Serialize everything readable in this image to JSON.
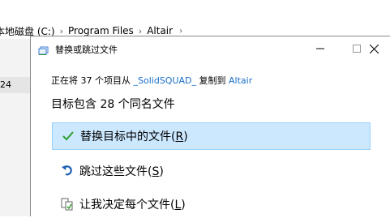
{
  "explorer": {
    "breadcrumb": [
      "本地磁盘 (C:)",
      "Program Files",
      "Altair"
    ],
    "list_value": "24"
  },
  "dialog": {
    "title": "替换或跳过文件",
    "status_prefix": "正在将 37 个项目从 ",
    "source": "_SolidSQUAD_",
    "status_middle": " 复制到 ",
    "destination": "Altair",
    "heading": "目标包含 28 个同名文件",
    "options": [
      {
        "label": "替换目标中的文件(",
        "key": "R",
        "suffix": ")",
        "icon": "check-icon"
      },
      {
        "label": "跳过这些文件(",
        "key": "S",
        "suffix": ")",
        "icon": "skip-arrow-icon"
      },
      {
        "label": "让我决定每个文件(",
        "key": "L",
        "suffix": ")",
        "icon": "decide-files-icon"
      }
    ]
  },
  "colors": {
    "accent": "#1a6fc9",
    "selected_bg": "#cce8ff",
    "selected_border": "#99d1ff",
    "check": "#2e9e2e"
  }
}
